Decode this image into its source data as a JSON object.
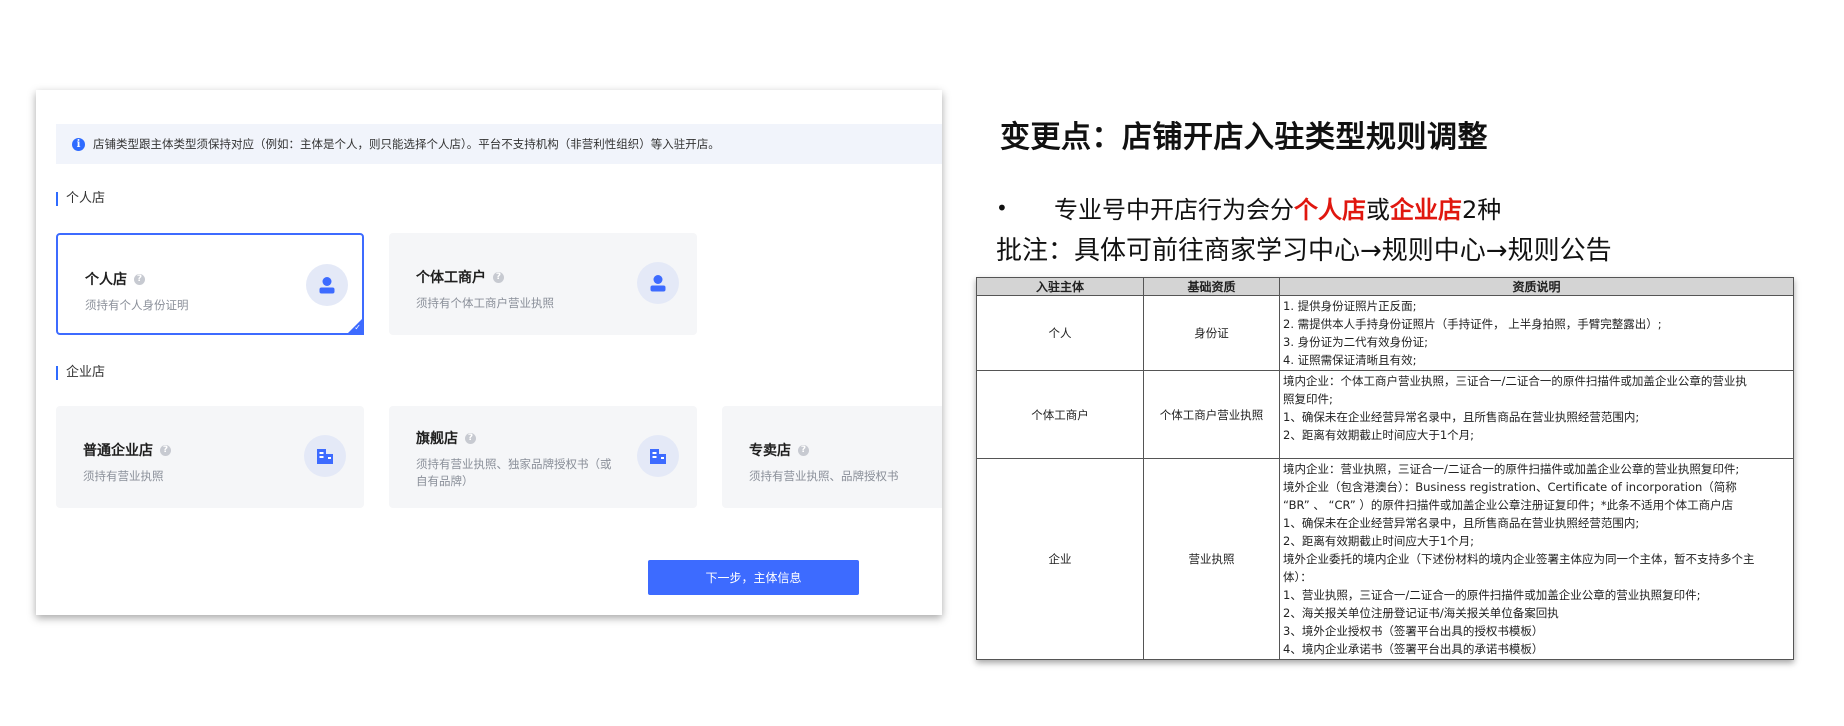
{
  "form": {
    "notice": "店铺类型跟主体类型须保持对应（例如：主体是个人，则只能选择个人店）。平台不支持机构（非营利性组织）等入驻开店。",
    "section_personal": "个人店",
    "section_enterprise": "企业店",
    "cards_personal": [
      {
        "title": "个人店",
        "desc": "须持有个人身份证明",
        "icon": "user-icon",
        "selected": true
      },
      {
        "title": "个体工商户",
        "desc": "须持有个体工商户营业执照",
        "icon": "user-icon",
        "selected": false
      }
    ],
    "cards_enterprise": [
      {
        "title": "普通企业店",
        "desc": "须持有营业执照",
        "icon": "building-icon"
      },
      {
        "title": "旗舰店",
        "desc_line1": "须持有营业执照、独家品牌授权书（或",
        "desc_line2": "自有品牌）",
        "icon": "building-icon"
      },
      {
        "title": "专卖店",
        "desc": "须持有营业执照、品牌授权书",
        "icon": "building-icon"
      }
    ],
    "next_button": "下一步，主体信息"
  },
  "slide": {
    "title": "变更点：店铺开店入驻类型规则调整",
    "bullet_prefix": "专业号中开店行为会分",
    "bullet_red1": "个人店",
    "bullet_mid": "或",
    "bullet_red2": "企业店",
    "bullet_suffix": "2种",
    "note": "批注：具体可前往商家学习中心→规则中心→规则公告",
    "accent_color": "#e0170f"
  },
  "table": {
    "headers": [
      "入驻主体",
      "基础资质",
      "资质说明"
    ],
    "rows": [
      {
        "subject": "个人",
        "qualification": "身份证",
        "lines": [
          "1. 提供身份证照片正反面;",
          "2. 需提供本人手持身份证照片（手持证件，  上半身拍照，手臂完整露出）;",
          "3. 身份证为二代有效身份证;",
          "4. 证照需保证清晰且有效;"
        ]
      },
      {
        "subject": "个体工商户",
        "qualification": "个体工商户营业执照",
        "lines": [
          "境内企业：个体工商户营业执照，三证合一/二证合一的原件扫描件或加盖企业公章的营业执",
          "照复印件;",
          "1、确保未在企业经营异常名录中，且所售商品在营业执照经营范围内;",
          "2、距离有效期截止时间应大于1个月;"
        ]
      },
      {
        "subject": "企业",
        "qualification": "营业执照",
        "lines": [
          "境内企业：营业执照，三证合一/二证合一的原件扫描件或加盖企业公章的营业执照复印件;",
          "境外企业（包含港澳台）：Business registration、Certificate of incorporation（简称",
          "  “BR” 、 “CR” ）的原件扫描件或加盖企业公章注册证复印件；*此条不适用个体工商户店",
          "1、确保未在企业经营异常名录中，且所售商品在营业执照经营范围内;",
          "2、距离有效期截止时间应大于1个月;",
          "境外企业委托的境内企业（下述份材料的境内企业签署主体应为同一个主体，暂不支持多个主",
          "体）：",
          "1、营业执照，三证合一/二证合一的原件扫描件或加盖企业公章的营业执照复印件;",
          "2、海关报关单位注册登记证书/海关报关单位备案回执",
          "3、境外企业授权书（签署平台出具的授权书模板）",
          "4、境内企业承诺书（签署平台出具的承诺书模板）"
        ]
      }
    ]
  }
}
